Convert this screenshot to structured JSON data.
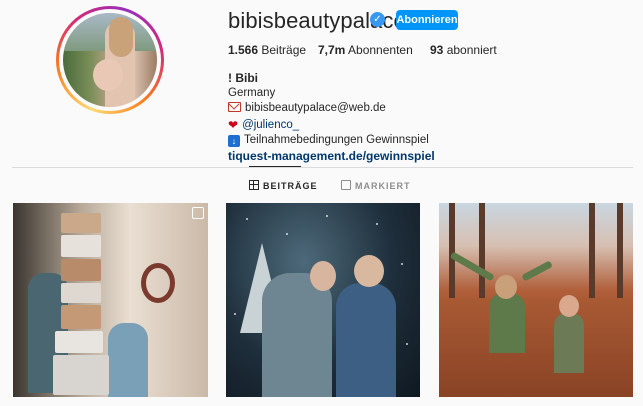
{
  "profile": {
    "username": "bibisbeautypalace",
    "follow_label": "Abonnieren",
    "stats": {
      "posts_count": "1.566",
      "posts_label": "Beiträge",
      "followers_count": "7,7m",
      "followers_label": "Abonnenten",
      "following_count": "93",
      "following_label": "abonniert"
    },
    "name": "! Bibi",
    "bio": {
      "location": "Germany",
      "email": "bibisbeautypalace@web.de",
      "mention": "@julienco_",
      "terms": "Teilnahmebedingungen Gewinnspiel",
      "link": "tiquest-management.de/gewinnspiel"
    }
  },
  "tabs": {
    "posts": "BEITRÄGE",
    "tagged": "MARKIERT"
  },
  "icons": {
    "verified": "verified-badge-icon",
    "email": "envelope-icon",
    "heart": "red-heart-icon",
    "info": "down-arrow-icon",
    "grid": "grid-icon",
    "tagged": "tagged-user-icon",
    "carousel": "carousel-icon"
  },
  "colors": {
    "accent": "#0095f6",
    "link": "#00376b",
    "verified": "#3897f0"
  }
}
